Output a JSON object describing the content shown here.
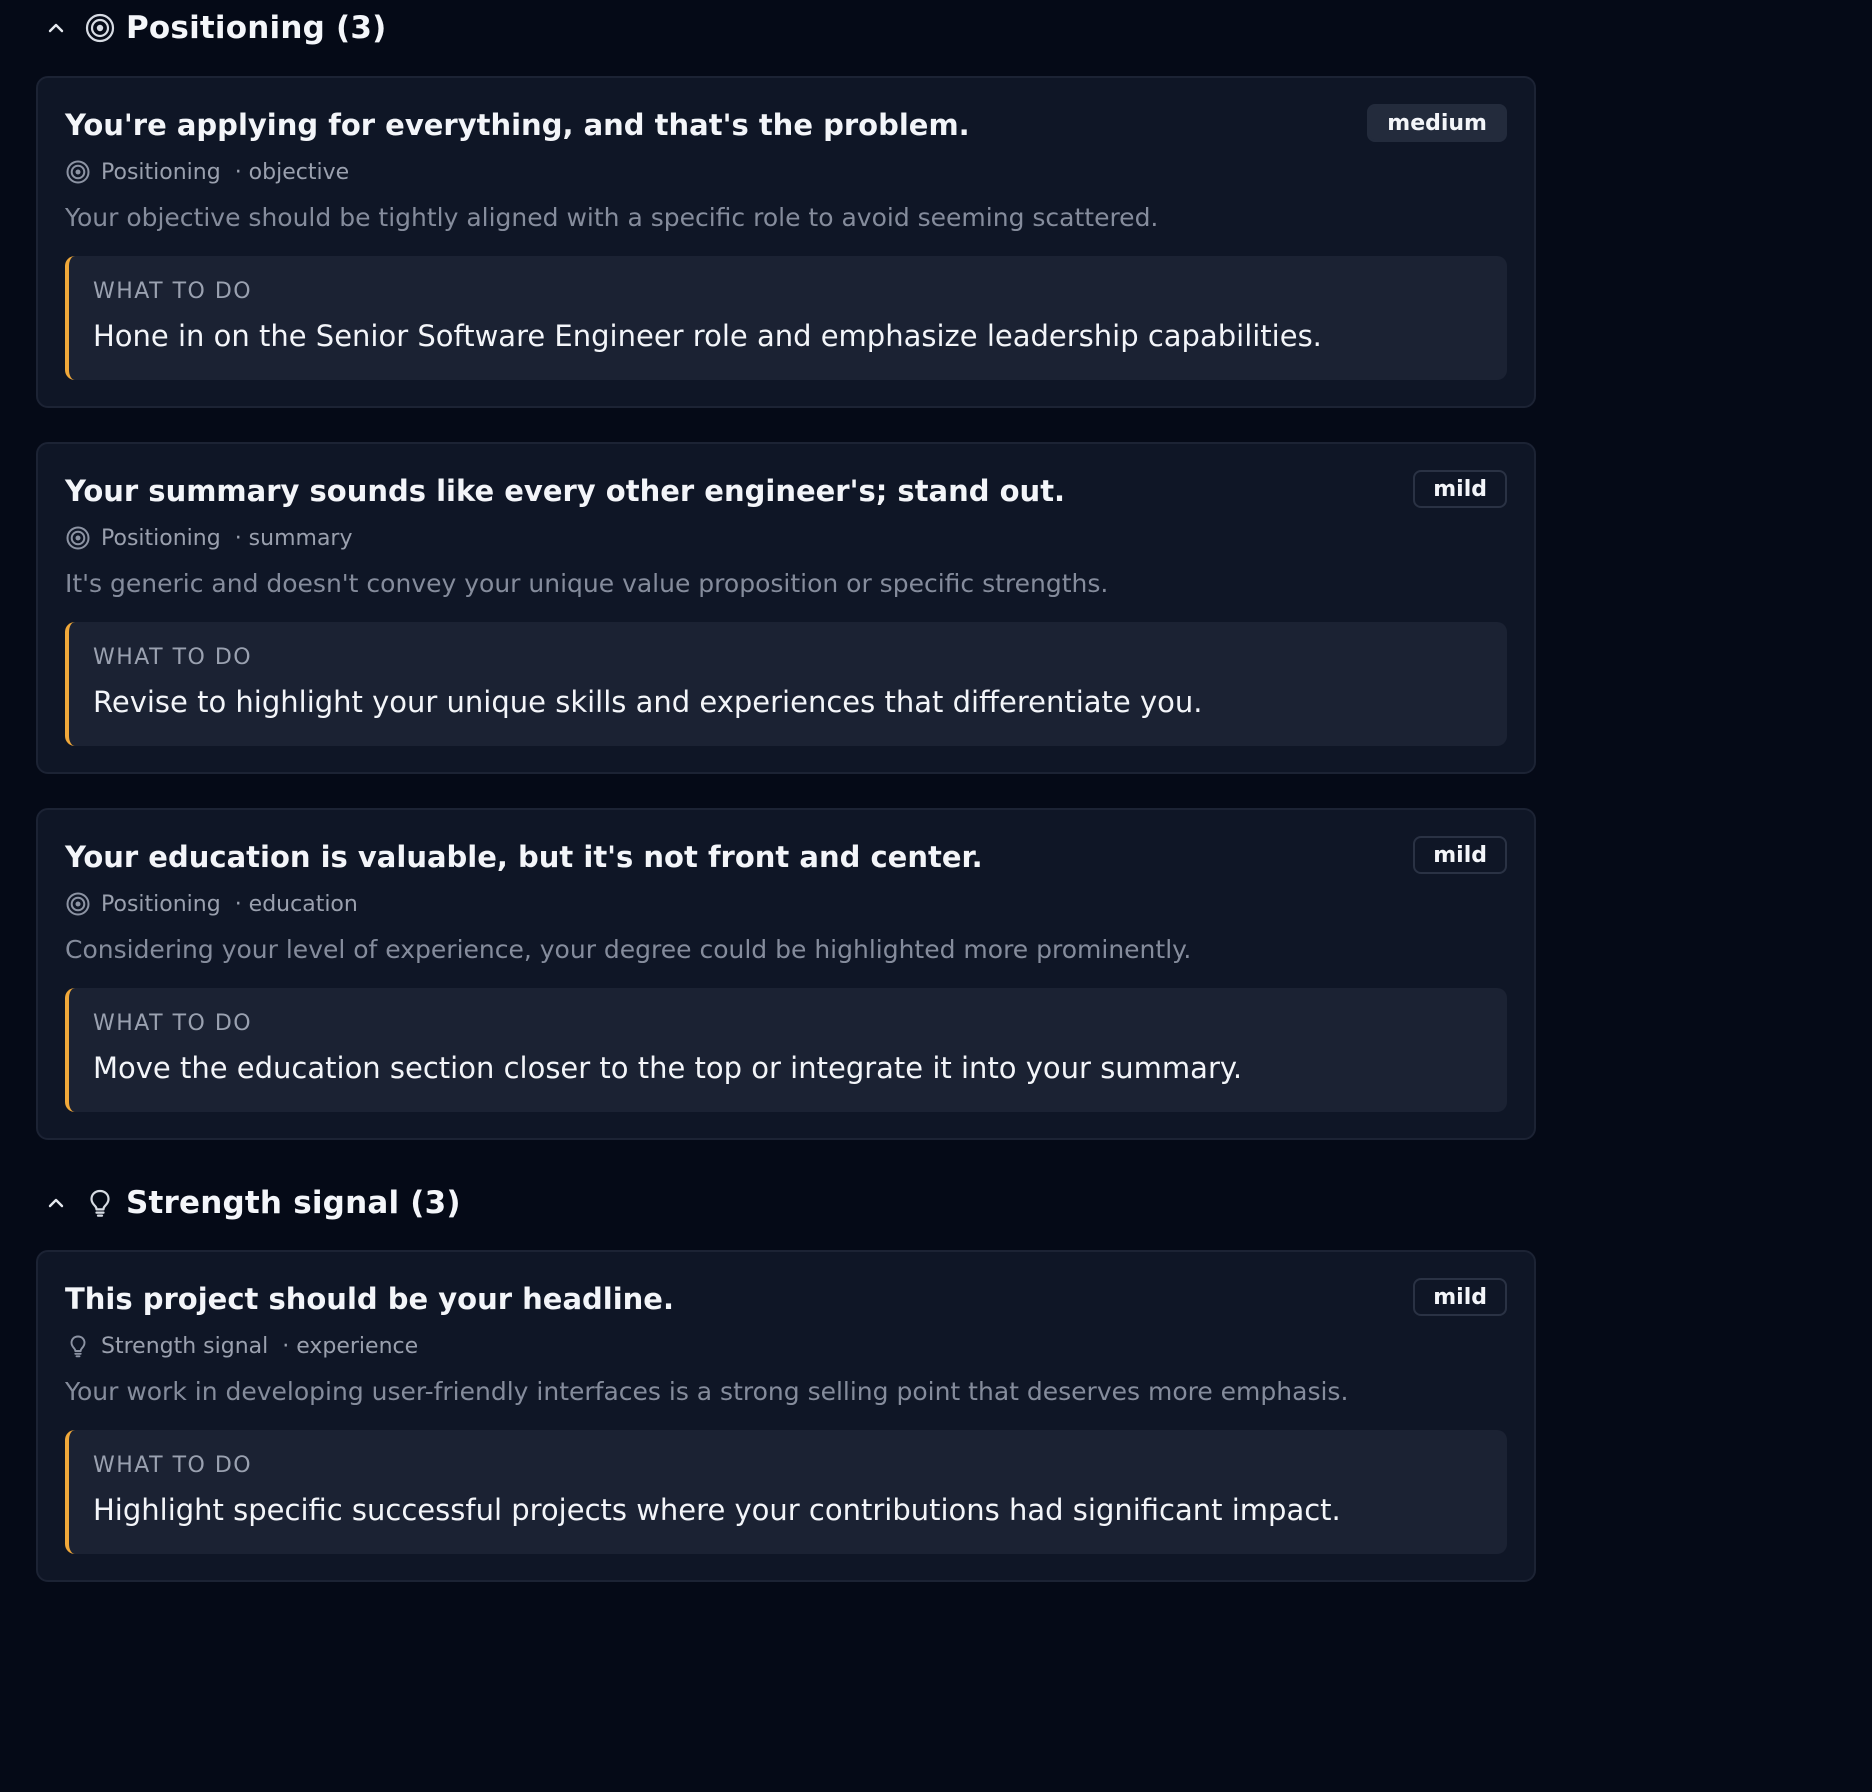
{
  "sections": [
    {
      "title": "Positioning (3)",
      "icon": "target-icon",
      "cards": [
        {
          "title": "You're applying for everything, and that's the problem.",
          "severity": "medium",
          "category": "Positioning",
          "field": "· objective",
          "description": "Your objective should be tightly aligned with a specific role to avoid seeming scattered.",
          "todo_label": "WHAT TO DO",
          "todo_text": "Hone in on the Senior Software Engineer role and emphasize leadership capabilities."
        },
        {
          "title": "Your summary sounds like every other engineer's; stand out.",
          "severity": "mild",
          "category": "Positioning",
          "field": "· summary",
          "description": "It's generic and doesn't convey your unique value proposition or specific strengths.",
          "todo_label": "WHAT TO DO",
          "todo_text": "Revise to highlight your unique skills and experiences that differentiate you."
        },
        {
          "title": "Your education is valuable, but it's not front and center.",
          "severity": "mild",
          "category": "Positioning",
          "field": "· education",
          "description": "Considering your level of experience, your degree could be highlighted more prominently.",
          "todo_label": "WHAT TO DO",
          "todo_text": "Move the education section closer to the top or integrate it into your summary."
        }
      ]
    },
    {
      "title": "Strength signal (3)",
      "icon": "lightbulb-icon",
      "cards": [
        {
          "title": "This project should be your headline.",
          "severity": "mild",
          "category": "Strength signal",
          "field": "· experience",
          "description": "Your work in developing user-friendly interfaces is a strong selling point that deserves more emphasis.",
          "todo_label": "WHAT TO DO",
          "todo_text": "Highlight specific successful projects where your contributions had significant impact."
        }
      ]
    }
  ],
  "colors": {
    "background": "#050a17",
    "card": "#0f1626",
    "todo_bg": "#1b2233",
    "accent": "#f0a83a"
  }
}
